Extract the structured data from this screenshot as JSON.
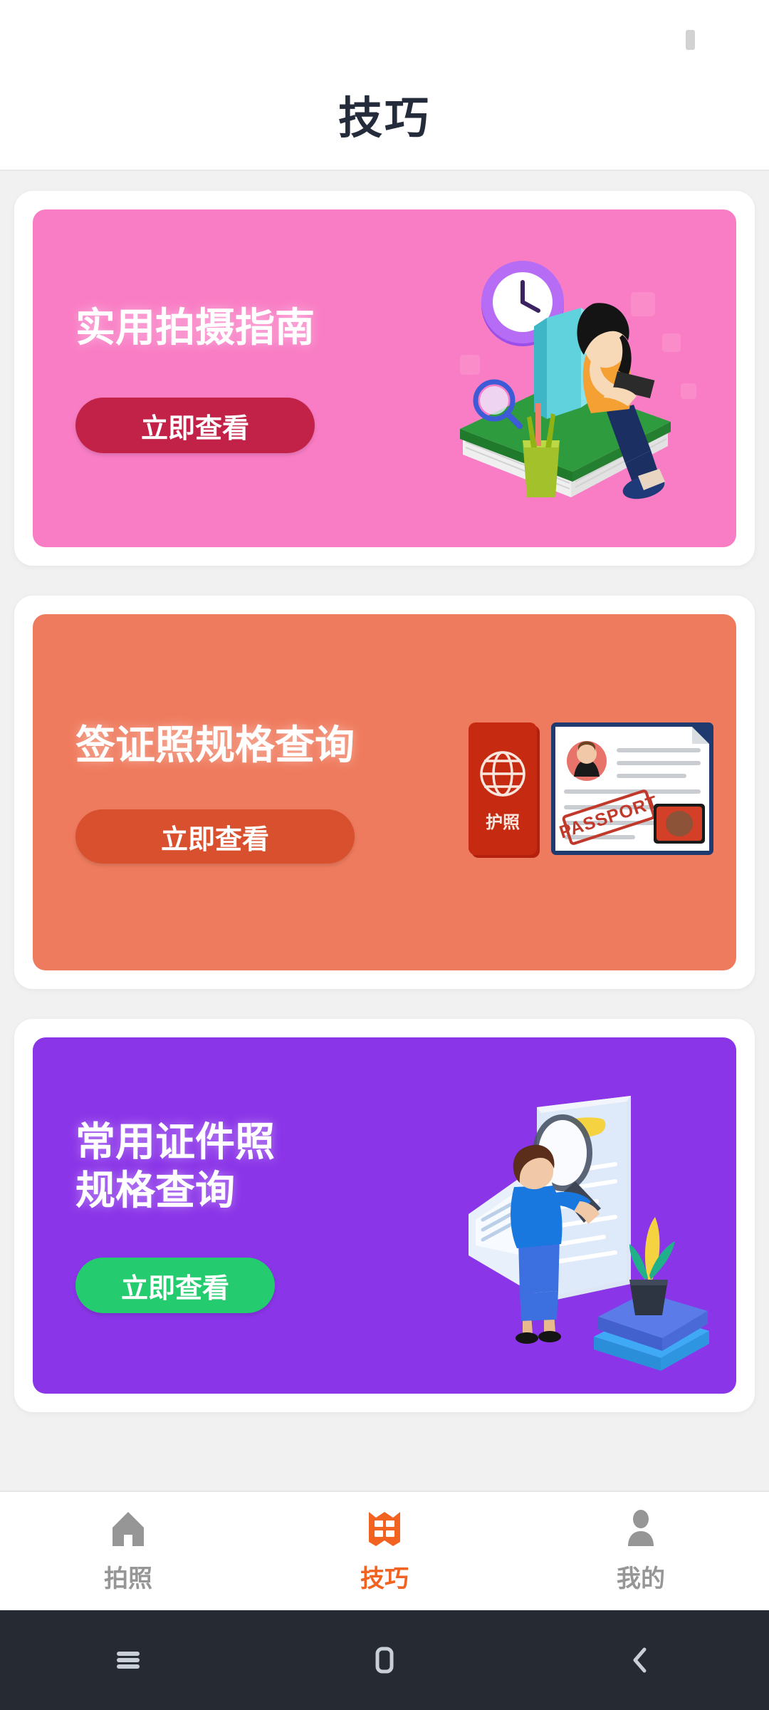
{
  "status_bar": {
    "battery_icon": "battery-icon"
  },
  "header": {
    "title": "技巧"
  },
  "cards": [
    {
      "id": "practical-shooting-guide",
      "title": "实用拍摄指南",
      "cta_label": "立即查看",
      "background_color": "#F97DC4",
      "cta_color": "#C32248",
      "illustration": "woman-reading-on-books-with-clock"
    },
    {
      "id": "visa-photo-spec-lookup",
      "title": "签证照规格查询",
      "cta_label": "立即查看",
      "background_color": "#EF7B5E",
      "cta_color": "#D9502F",
      "illustration": "passport-and-id-document",
      "passport_label": "护照",
      "stamp_label": "PASSPORT"
    },
    {
      "id": "common-id-photo-spec-lookup",
      "title": "常用证件照\n规格查询",
      "cta_label": "立即查看",
      "background_color": "#8B35E8",
      "cta_color": "#24CC6F",
      "illustration": "woman-inspecting-document-with-magnifier"
    }
  ],
  "tab_bar": {
    "items": [
      {
        "label": "拍照",
        "icon": "home-icon",
        "active": false,
        "color": "#969696"
      },
      {
        "label": "技巧",
        "icon": "book-icon",
        "active": true,
        "color": "#F26322"
      },
      {
        "label": "我的",
        "icon": "person-icon",
        "active": false,
        "color": "#969696"
      }
    ]
  },
  "android_nav": {
    "recents_icon": "menu-icon",
    "home_icon": "home-square-icon",
    "back_icon": "chevron-left-icon"
  }
}
